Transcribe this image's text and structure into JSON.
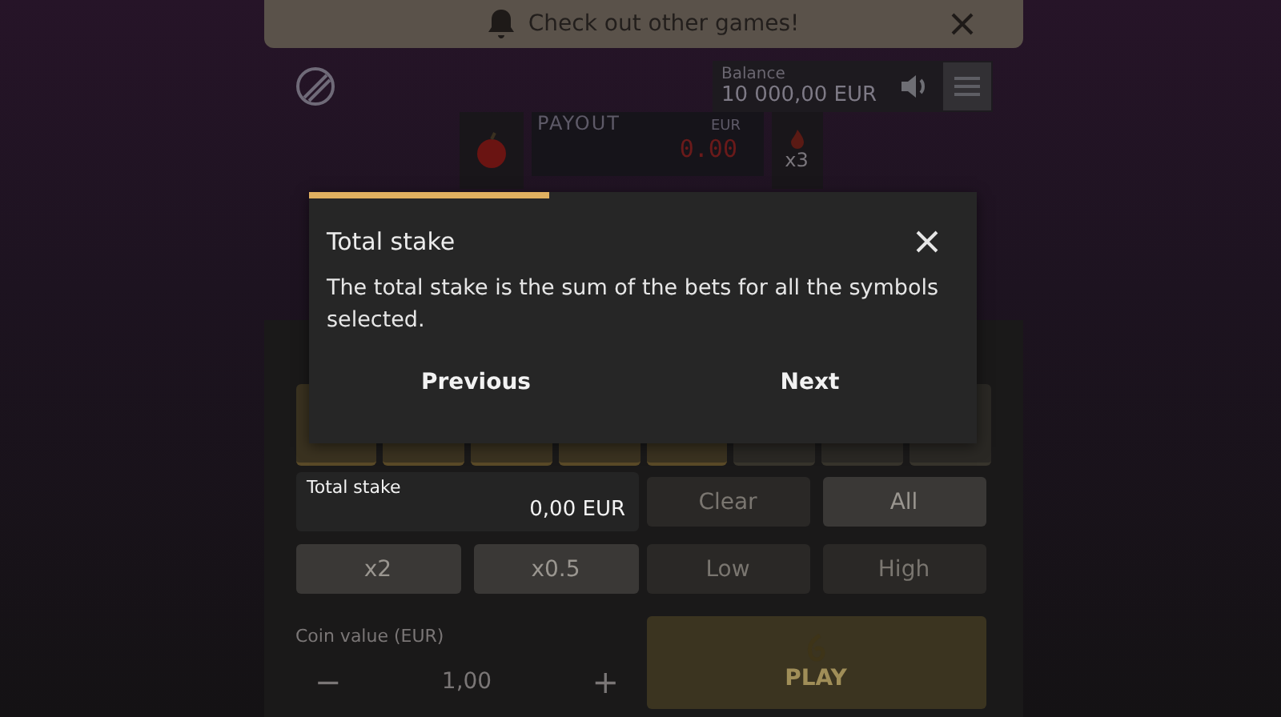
{
  "notification": {
    "text": "Check out other games!"
  },
  "header": {
    "balance_label": "Balance",
    "balance_value": "10 000,00 EUR"
  },
  "display": {
    "payout_label": "PAYOUT",
    "currency": "EUR",
    "payout_value": "0.00",
    "multiplier": "x3"
  },
  "tour": {
    "title": "Total stake",
    "body": "The total stake is the sum of the bets for all the symbols selected.",
    "progress": {
      "level": 0.36
    },
    "buttons": [
      "Previous",
      "Next"
    ]
  },
  "total_stake": {
    "label": "Total stake",
    "value": "0,00 EUR"
  },
  "bet_buttons": [
    {
      "label": "Clear",
      "disabled": true
    },
    {
      "label": "All",
      "disabled": false
    },
    {
      "label": "x2",
      "disabled": false
    },
    {
      "label": "x0.5",
      "disabled": false
    },
    {
      "label": "Low",
      "disabled": true
    },
    {
      "label": "High",
      "disabled": true
    }
  ],
  "coin": {
    "label": "Coin value (EUR)",
    "minus": "−",
    "value": "1,00",
    "plus": "+"
  },
  "play": {
    "label": "PLAY"
  }
}
